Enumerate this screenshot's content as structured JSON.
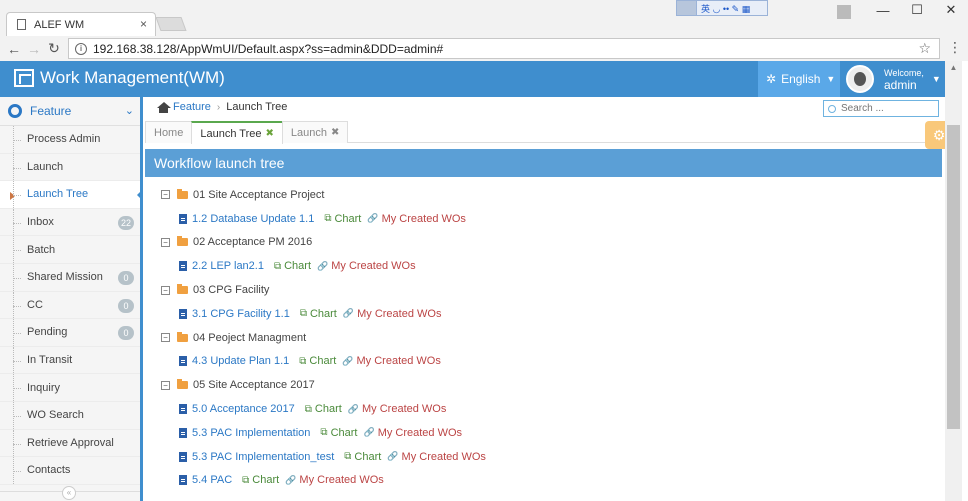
{
  "browser": {
    "tab_title": "ALEF WM",
    "tab_close": "×",
    "url": "192.168.38.128/AppWmUI/Default.aspx?ss=admin&DDD=admin#",
    "ime_text": "英 ◡ •• ✎ ▦",
    "win_minimize": "—",
    "win_maximize": "☐",
    "win_close": "✕"
  },
  "header": {
    "title": "Work Management(WM)",
    "language": "English",
    "welcome": "Welcome,",
    "username": "admin"
  },
  "sidebar": {
    "section": "Feature",
    "items": [
      {
        "label": "Process Admin",
        "badge": null
      },
      {
        "label": "Launch",
        "badge": null
      },
      {
        "label": "Launch Tree",
        "badge": null,
        "active": true
      },
      {
        "label": "Inbox",
        "badge": "22"
      },
      {
        "label": "Batch",
        "badge": null
      },
      {
        "label": "Shared Mission",
        "badge": "0"
      },
      {
        "label": "CC",
        "badge": "0"
      },
      {
        "label": "Pending",
        "badge": "0"
      },
      {
        "label": "In Transit",
        "badge": null
      },
      {
        "label": "Inquiry",
        "badge": null
      },
      {
        "label": "WO Search",
        "badge": null
      },
      {
        "label": "Retrieve Approval",
        "badge": null
      },
      {
        "label": "Contacts",
        "badge": null
      }
    ]
  },
  "breadcrumb": {
    "root": "Feature",
    "current": "Launch Tree"
  },
  "search": {
    "placeholder": "Search ..."
  },
  "tabs": [
    {
      "label": "Home",
      "closable": false,
      "active": false
    },
    {
      "label": "Launch Tree",
      "closable": true,
      "active": true
    },
    {
      "label": "Launch",
      "closable": true,
      "active": false
    }
  ],
  "panel": {
    "title": "Workflow launch tree"
  },
  "tree_links": {
    "chart": "Chart",
    "my_wos": "My Created WOs"
  },
  "tree": [
    {
      "type": "folder",
      "label": "01 Site Acceptance Project"
    },
    {
      "type": "leaf",
      "label": "1.2 Database Update 1.1"
    },
    {
      "type": "folder",
      "label": "02 Acceptance PM 2016"
    },
    {
      "type": "leaf",
      "label": "2.2 LEP lan2.1"
    },
    {
      "type": "folder",
      "label": "03 CPG Facility"
    },
    {
      "type": "leaf",
      "label": "3.1 CPG Facility 1.1"
    },
    {
      "type": "folder",
      "label": "04 Peoject Managment"
    },
    {
      "type": "leaf",
      "label": "4.3 Update Plan 1.1"
    },
    {
      "type": "folder",
      "label": "05 Site Acceptance 2017"
    },
    {
      "type": "leaf",
      "label": "5.0 Acceptance 2017"
    },
    {
      "type": "leaf",
      "label": "5.3 PAC Implementation"
    },
    {
      "type": "leaf",
      "label": "5.3 PAC Implementation_test"
    },
    {
      "type": "leaf",
      "label": "5.4 PAC"
    }
  ],
  "colors": {
    "header_bg": "#3f8ece",
    "panel_head": "#5b9fd6",
    "link_blue": "#2b78c5",
    "chart_green": "#4a8a3a",
    "wo_red": "#b44444"
  }
}
